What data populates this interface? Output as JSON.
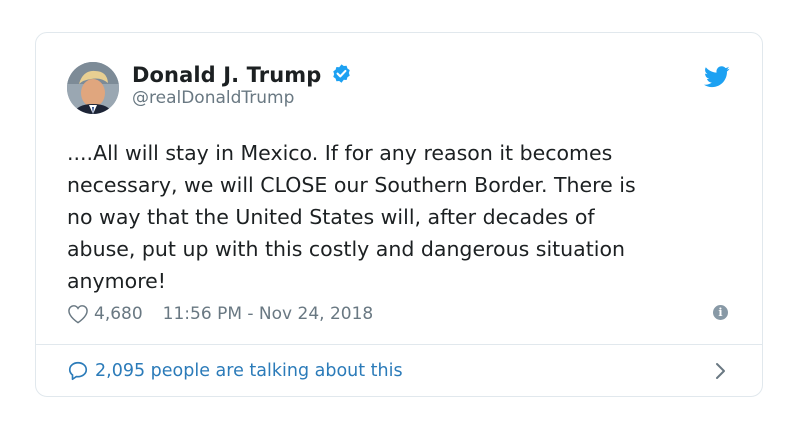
{
  "tweet": {
    "author": {
      "display_name": "Donald J. Trump",
      "handle": "@realDonaldTrump",
      "verified": true
    },
    "text": "....All will stay in Mexico. If for any reason it becomes\nnecessary, we will CLOSE our Southern Border. There is\nno way that the United States will, after decades of\nabuse, put up with this costly and dangerous situation\nanymore!",
    "likes": "4,680",
    "timestamp": "11:56 PM - Nov 24, 2018",
    "conversation_label": "2,095 people are talking about this"
  },
  "icons": {
    "brand": "twitter-bird-icon",
    "like": "heart-icon",
    "info": "info-icon",
    "reply": "speech-bubble-icon",
    "chevron": "chevron-right-icon",
    "verified": "verified-badge-icon"
  },
  "colors": {
    "brand_blue": "#1da1f2",
    "link_blue": "#2b7bb9",
    "muted_gray": "#697882",
    "border": "#e1e8ed"
  }
}
